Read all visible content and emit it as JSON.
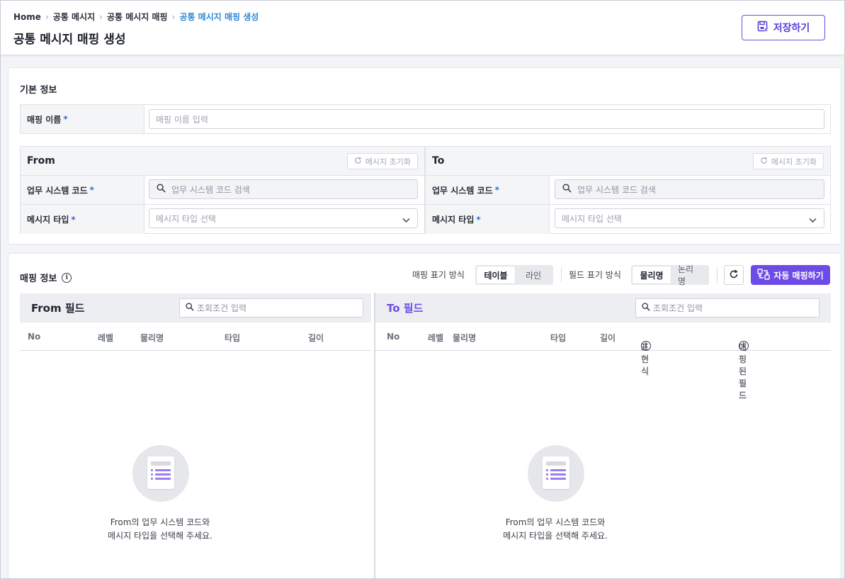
{
  "breadcrumb": {
    "items": [
      "Home",
      "공통 메시지",
      "공통 메시지 매핑"
    ],
    "current": "공통 메시지 매핑 생성",
    "separator": "›"
  },
  "page_title": "공통 메시지 매핑 생성",
  "save_label": "저장하기",
  "basic_info": {
    "title": "기본 정보",
    "mapping_name_label": "매핑 이름",
    "required_mark": "*",
    "mapping_name_placeholder": "매핑 이름 입력"
  },
  "from": {
    "title": "From",
    "reset_label": "메시지 초기화",
    "system_code_label": "업무 시스템 코드",
    "system_code_placeholder": "업무 시스템 코드 검색",
    "message_type_label": "메시지 타입",
    "message_type_placeholder": "메시지 타입 선택"
  },
  "to": {
    "title": "To",
    "reset_label": "메시지 초기화",
    "system_code_label": "업무 시스템 코드",
    "system_code_placeholder": "업무 시스템 코드 검색",
    "message_type_label": "메시지 타입",
    "message_type_placeholder": "메시지 타입 선택"
  },
  "mapping_info": {
    "title": "매핑 정보",
    "display_mode_label": "매핑 표기 방식",
    "display_modes": [
      "테이블",
      "라인"
    ],
    "display_mode_selected": "테이블",
    "field_mode_label": "필드 표기 방식",
    "field_modes": [
      "물리명",
      "논리명"
    ],
    "field_mode_selected": "물리명",
    "auto_map_label": "자동 매핑하기"
  },
  "from_fields": {
    "title": "From 필드",
    "search_placeholder": "조회조건 입력",
    "columns": [
      "No",
      "레벨",
      "물리명",
      "타입",
      "길이"
    ],
    "empty_line1": "From의 업무 시스템 코드와",
    "empty_line2": "메시지 타입을 선택해 주세요."
  },
  "to_fields": {
    "title": "To 필드",
    "search_placeholder": "조회조건 입력",
    "columns": [
      "No",
      "레벨",
      "물리명",
      "타입",
      "길이",
      "표현식",
      "매핑된 필드"
    ],
    "empty_line1": "From의 업무 시스템 코드와",
    "empty_line2": "메시지 타입을 선택해 주세요."
  },
  "colors": {
    "accent": "#6e4be6",
    "breadcrumb_current": "#2f8bd6",
    "to_title": "#6e4be6"
  }
}
